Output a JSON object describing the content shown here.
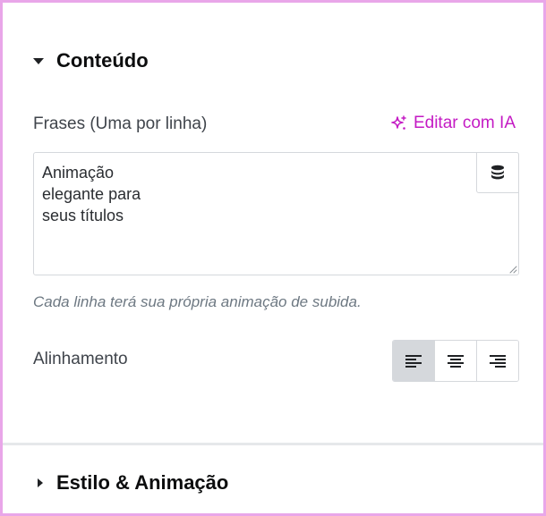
{
  "sections": {
    "content": {
      "title": "Conteúdo",
      "expanded": true
    },
    "style": {
      "title": "Estilo & Animação",
      "expanded": false
    }
  },
  "phrases_field": {
    "label": "Frases (Uma por linha)",
    "ai_link": "Editar com IA",
    "value": "Animação\nelegante para\nseus títulos",
    "dynamic_icon": "database-icon",
    "help": "Cada linha terá sua própria animação de subida."
  },
  "alignment": {
    "label": "Alinhamento",
    "options": [
      "align-left",
      "align-center",
      "align-right"
    ],
    "selected": "align-left"
  },
  "colors": {
    "accent": "#c41bc4",
    "frame": "#e9a6e9",
    "active_button": "#d5d8dc"
  }
}
